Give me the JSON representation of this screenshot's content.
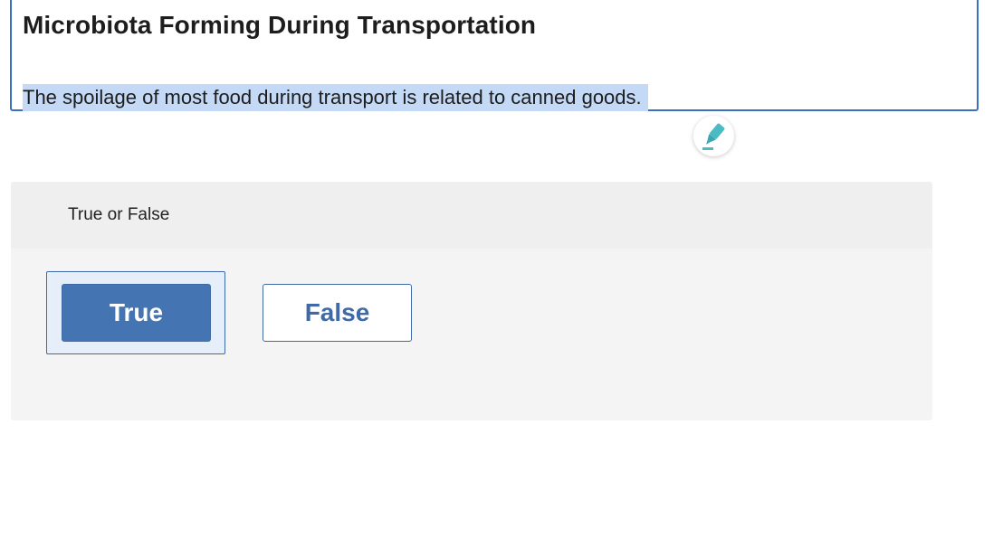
{
  "question": {
    "title": "Microbiota Forming During Transportation",
    "text": "The spoilage of most food during transport is related to canned goods."
  },
  "tools": {
    "highlighter_icon": "highlighter-marker-icon",
    "highlighter_color": "#4bbac3"
  },
  "answer": {
    "type_label": "True or False",
    "options": [
      {
        "label": "True",
        "selected": true
      },
      {
        "label": "False",
        "selected": false
      }
    ]
  },
  "colors": {
    "accent": "#4474b2",
    "selection": "#c3d9f5",
    "focus_border": "#3a6fc4"
  }
}
